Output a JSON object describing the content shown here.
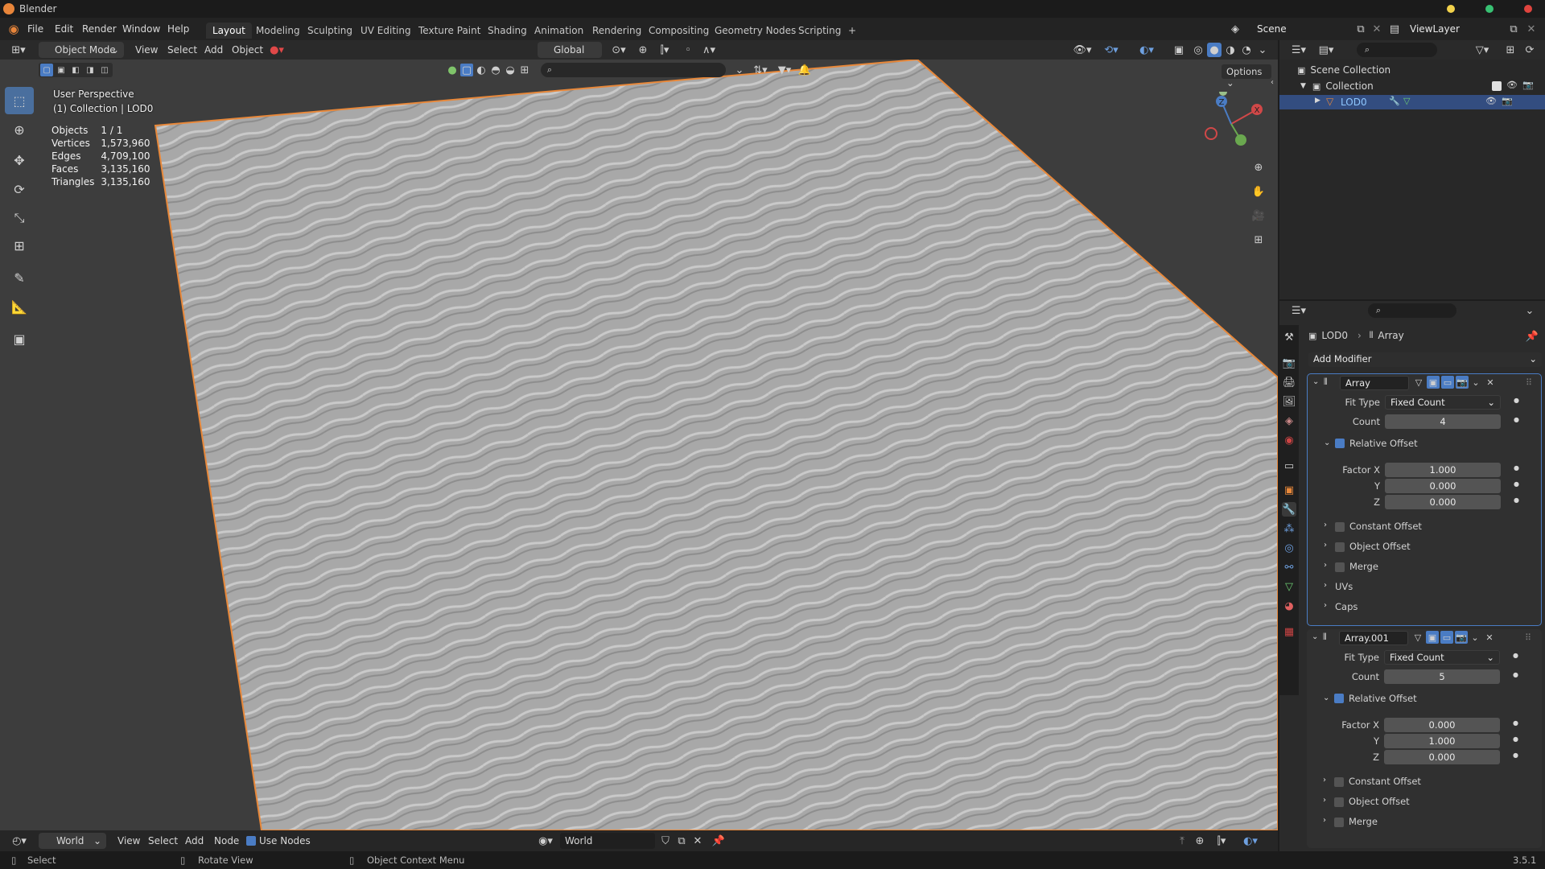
{
  "app": {
    "title": "Blender",
    "version": "3.5.1"
  },
  "menu": [
    "File",
    "Edit",
    "Render",
    "Window",
    "Help"
  ],
  "workspaces": [
    "Layout",
    "Modeling",
    "Sculpting",
    "UV Editing",
    "Texture Paint",
    "Shading",
    "Animation",
    "Rendering",
    "Compositing",
    "Geometry Nodes",
    "Scripting",
    "+"
  ],
  "scene": {
    "label": "Scene",
    "view_layer": "ViewLayer"
  },
  "viewport_header": {
    "mode": "Object Mode",
    "view": "View",
    "select": "Select",
    "add": "Add",
    "object": "Object",
    "orientation": "Global",
    "options": "Options"
  },
  "overlay": {
    "perspective": "User Perspective",
    "collection": "(1) Collection | LOD0",
    "stats": [
      {
        "label": "Objects",
        "value": "1 / 1"
      },
      {
        "label": "Vertices",
        "value": "1,573,960"
      },
      {
        "label": "Edges",
        "value": "4,709,100"
      },
      {
        "label": "Faces",
        "value": "3,135,160"
      },
      {
        "label": "Triangles",
        "value": "3,135,160"
      }
    ]
  },
  "outliner": {
    "scene_collection": "Scene Collection",
    "collection": "Collection",
    "object": "LOD0"
  },
  "properties": {
    "breadcrumb_object": "LOD0",
    "breadcrumb_modifier": "Array",
    "add_modifier": "Add Modifier",
    "modifiers": [
      {
        "name": "Array",
        "fit_type_label": "Fit Type",
        "fit_type": "Fixed Count",
        "count_label": "Count",
        "count": "4",
        "relative_offset": "Relative Offset",
        "factor_x_label": "Factor X",
        "y_label": "Y",
        "z_label": "Z",
        "factor_x": "1.000",
        "factor_y": "0.000",
        "factor_z": "0.000",
        "subpanels": [
          "Constant Offset",
          "Object Offset",
          "Merge",
          "UVs",
          "Caps"
        ]
      },
      {
        "name": "Array.001",
        "fit_type_label": "Fit Type",
        "fit_type": "Fixed Count",
        "count_label": "Count",
        "count": "5",
        "relative_offset": "Relative Offset",
        "factor_x_label": "Factor X",
        "y_label": "Y",
        "z_label": "Z",
        "factor_x": "0.000",
        "factor_y": "1.000",
        "factor_z": "0.000",
        "subpanels": [
          "Constant Offset",
          "Object Offset",
          "Merge"
        ]
      }
    ]
  },
  "footer": {
    "world_mode": "World",
    "view": "View",
    "select": "Select",
    "add": "Add",
    "node": "Node",
    "use_nodes": "Use Nodes",
    "world": "World"
  },
  "statusbar": {
    "select": "Select",
    "rotate": "Rotate View",
    "context": "Object Context Menu"
  },
  "colors": {
    "accent": "#4a7cc4",
    "selection_outline": "#e8883a",
    "active_tool": "#4a6f9e"
  }
}
